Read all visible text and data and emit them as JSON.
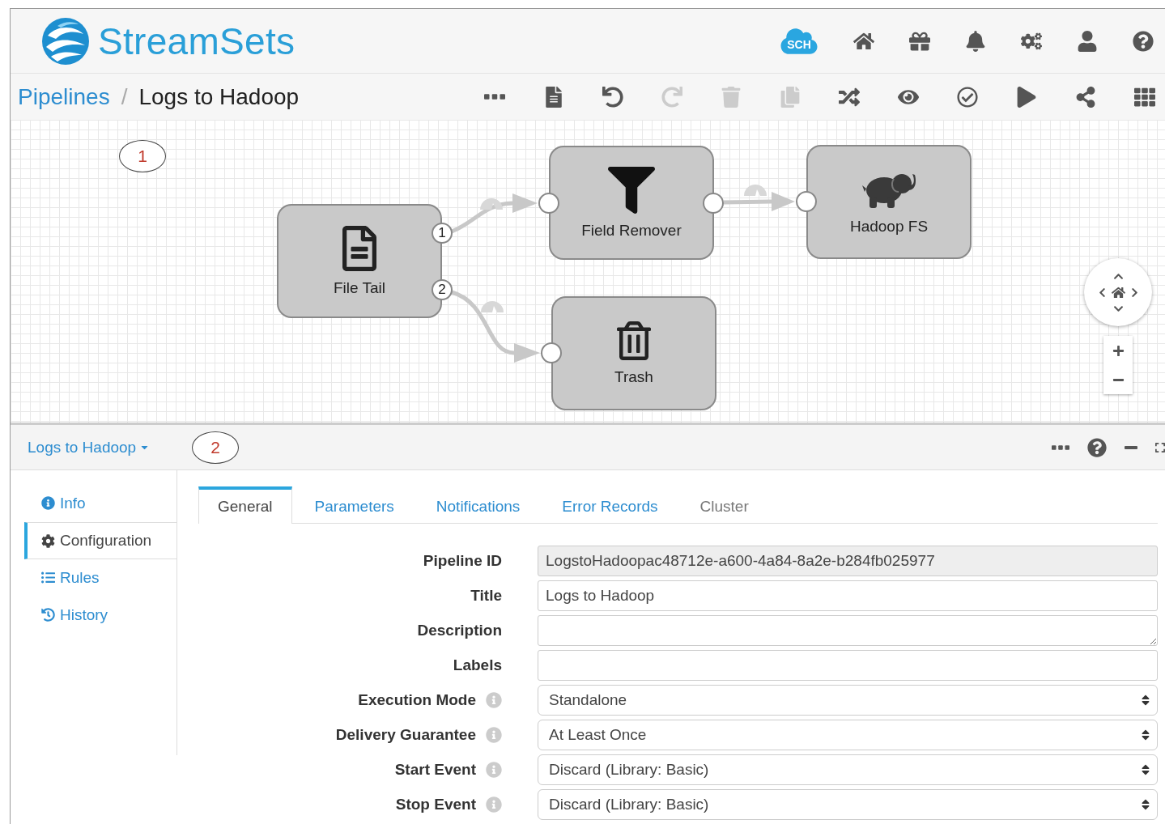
{
  "header": {
    "brand": "StreamSets",
    "cloud_badge": "SCH",
    "icons": [
      {
        "kind": "home"
      },
      {
        "kind": "gift"
      },
      {
        "kind": "bell"
      },
      {
        "kind": "gears"
      },
      {
        "kind": "user"
      },
      {
        "kind": "help"
      }
    ]
  },
  "breadcrumb": {
    "parent": "Pipelines",
    "separator": "/",
    "current": "Logs to Hadoop"
  },
  "toolbar": [
    {
      "kind": "more",
      "disabled": false
    },
    {
      "kind": "file",
      "disabled": false
    },
    {
      "kind": "undo",
      "disabled": false
    },
    {
      "kind": "redo",
      "disabled": true
    },
    {
      "kind": "delete",
      "disabled": true
    },
    {
      "kind": "copy",
      "disabled": true
    },
    {
      "kind": "shuffle",
      "disabled": false
    },
    {
      "kind": "preview",
      "disabled": false
    },
    {
      "kind": "validate",
      "disabled": false
    },
    {
      "kind": "start",
      "disabled": false
    },
    {
      "kind": "share",
      "disabled": false
    },
    {
      "kind": "grid",
      "disabled": false
    }
  ],
  "canvas": {
    "callout": "1",
    "stages": [
      {
        "label": "File Tail",
        "kind": "document",
        "outputs": [
          "1",
          "2"
        ]
      },
      {
        "label": "Field Remover",
        "kind": "funnel"
      },
      {
        "label": "Hadoop FS",
        "kind": "elephant"
      },
      {
        "label": "Trash",
        "kind": "trash"
      }
    ]
  },
  "panel": {
    "title": "Logs to Hadoop",
    "callout": "2"
  },
  "sidebar": [
    {
      "label": "Info",
      "kind": "info",
      "selected": false
    },
    {
      "label": "Configuration",
      "kind": "gear",
      "selected": true
    },
    {
      "label": "Rules",
      "kind": "list",
      "selected": false
    },
    {
      "label": "History",
      "kind": "history",
      "selected": false
    }
  ],
  "tabs": [
    {
      "label": "General",
      "selected": true,
      "disabled": false
    },
    {
      "label": "Parameters",
      "selected": false,
      "disabled": false
    },
    {
      "label": "Notifications",
      "selected": false,
      "disabled": false
    },
    {
      "label": "Error Records",
      "selected": false,
      "disabled": false
    },
    {
      "label": "Cluster",
      "selected": false,
      "disabled": true
    }
  ],
  "fields": [
    {
      "label": "Pipeline ID",
      "kind": "readonly",
      "value": "LogstoHadoopac48712e-a600-4a84-8a2e-b284fb025977",
      "info": false
    },
    {
      "label": "Title",
      "kind": "text",
      "value": "Logs to Hadoop",
      "info": false
    },
    {
      "label": "Description",
      "kind": "textarea",
      "info": false
    },
    {
      "label": "Labels",
      "kind": "text",
      "info": false
    },
    {
      "label": "Execution Mode",
      "kind": "select",
      "value": "Standalone",
      "info": true
    },
    {
      "label": "Delivery Guarantee",
      "kind": "select",
      "value": "At Least Once",
      "info": true
    },
    {
      "label": "Start Event",
      "kind": "select",
      "value": "Discard (Library: Basic)",
      "info": true
    },
    {
      "label": "Stop Event",
      "kind": "select",
      "value": "Discard (Library: Basic)",
      "info": true
    }
  ]
}
